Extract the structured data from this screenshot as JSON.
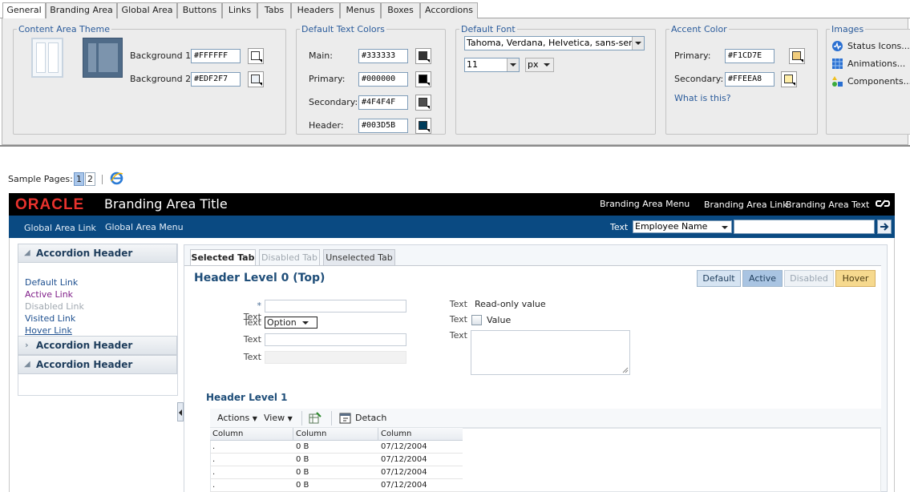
{
  "editor": {
    "tabs": [
      "General",
      "Branding Area",
      "Global Area",
      "Buttons",
      "Links",
      "Tabs",
      "Headers",
      "Menus",
      "Boxes",
      "Accordions"
    ],
    "content_area_theme": {
      "title": "Content Area Theme",
      "background1_label": "Background 1:",
      "background1_value": "#FFFFFF",
      "background2_label": "Background 2:",
      "background2_value": "#EDF2F7"
    },
    "text_colors": {
      "title": "Default Text Colors",
      "main_label": "Main:",
      "main_value": "#333333",
      "primary_label": "Primary:",
      "primary_value": "#000000",
      "secondary_label": "Secondary:",
      "secondary_value": "#4F4F4F",
      "header_label": "Header:",
      "header_value": "#003D5B"
    },
    "font": {
      "title": "Default Font",
      "family": "Tahoma, Verdana, Helvetica, sans-serif",
      "size": "11",
      "unit": "px"
    },
    "accent": {
      "title": "Accent Color",
      "primary_label": "Primary:",
      "primary_value": "#F1CD7E",
      "secondary_label": "Secondary:",
      "secondary_value": "#FFEEA8",
      "what_link": "What is this?"
    },
    "images": {
      "title": "Images",
      "status": "Status Icons...",
      "animations": "Animations...",
      "components": "Components..."
    }
  },
  "sample": {
    "label": "Sample Pages:",
    "page1": "1",
    "page2": "2"
  },
  "branding": {
    "logo": "ORACLE",
    "title": "Branding Area Title",
    "menu": "Branding Area Menu",
    "link": "Branding Area Link",
    "text": "Branding Area Text"
  },
  "global": {
    "link": "Global Area Link",
    "menu": "Global Area Menu",
    "search_label": "Text",
    "search_select": "Employee Name"
  },
  "accordion": {
    "header1": "Accordion Header",
    "header2": "Accordion Header",
    "header3": "Accordion Header",
    "links": {
      "default": "Default Link",
      "active": "Active Link",
      "disabled": "Disabled Link",
      "visited": "Visited Link",
      "hover": "Hover Link"
    }
  },
  "main": {
    "tabs": {
      "selected": "Selected Tab",
      "disabled": "Disabled Tab",
      "unselected": "Unselected Tab"
    },
    "header0": "Header Level 0 (Top)",
    "states": {
      "default": "Default",
      "active": "Active",
      "disabled": "Disabled",
      "hover": "Hover"
    },
    "form": {
      "required_mark": "*",
      "label": "Text",
      "select_value": "Option",
      "readonly_value": "Read-only value",
      "checkbox_label": "Value"
    },
    "header1": "Header Level 1",
    "toolbar": {
      "actions": "Actions",
      "view": "View",
      "detach": "Detach"
    },
    "table": {
      "columns": [
        "Column",
        "Column",
        "Column"
      ],
      "rows": [
        [
          ".",
          "0 B",
          "07/12/2004"
        ],
        [
          ".",
          "0 B",
          "07/12/2004"
        ],
        [
          ".",
          "0 B",
          "07/12/2004"
        ],
        [
          ".",
          "0 B",
          "07/12/2004"
        ]
      ]
    }
  },
  "colors": {
    "brand_bar": "#000000",
    "global_bar": "#0a4a82",
    "accent_primary": "#F1CD7E",
    "accent_secondary": "#FFEEA8",
    "header_text": "#003D5B",
    "oracle_red": "#E8322D"
  }
}
